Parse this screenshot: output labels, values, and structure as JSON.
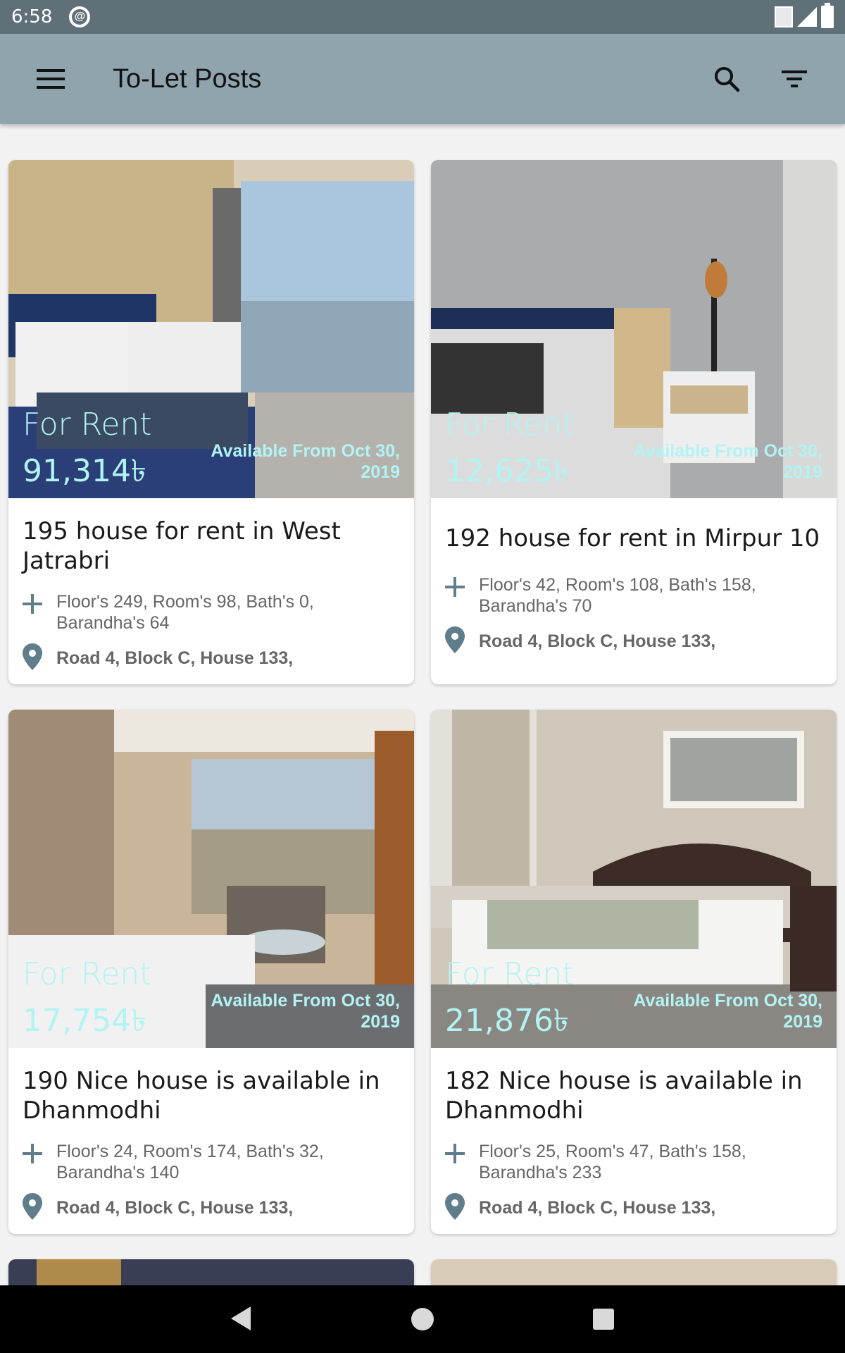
{
  "status": {
    "time": "6:58"
  },
  "app_bar": {
    "title": "To-Let Posts"
  },
  "posts": [
    {
      "tag": "For Rent",
      "price": "91,314৳",
      "available": "Available From Oct 30, 2019",
      "title": "195 house for rent in West Jatrabri",
      "details": "Floor's 249, Room's 98, Bath's 0, Barandha's 64",
      "address": "Road 4, Block C, House 133,"
    },
    {
      "tag": "For Rent",
      "price": "12,625৳",
      "available": "Available From Oct 30, 2019",
      "title": "192 house for rent in Mirpur 10",
      "details": "Floor's 42, Room's 108, Bath's 158, Barandha's 70",
      "address": "Road 4, Block C, House 133,"
    },
    {
      "tag": "For Rent",
      "price": "17,754৳",
      "available": "Available From Oct 30, 2019",
      "title": "190 Nice house is available in Dhanmodhi",
      "details": "Floor's 24, Room's 174, Bath's 32, Barandha's 140",
      "address": "Road 4, Block C, House 133,"
    },
    {
      "tag": "For Rent",
      "price": "21,876৳",
      "available": "Available From Oct 30, 2019",
      "title": "182 Nice house is available in Dhanmodhi",
      "details": "Floor's 25, Room's 47, Bath's 158, Barandha's 233",
      "address": "Road 4, Block C, House 133,"
    }
  ],
  "colors": {
    "app_bar": "#90a4ae",
    "status_bar": "#5f7079",
    "overlay_text": "#b2f3f3",
    "icon": "#607d8b"
  },
  "icons": {
    "menu": "menu-icon",
    "search": "search-icon",
    "filter": "filter-icon",
    "details": "plus-icon",
    "address": "location-pin-icon"
  }
}
